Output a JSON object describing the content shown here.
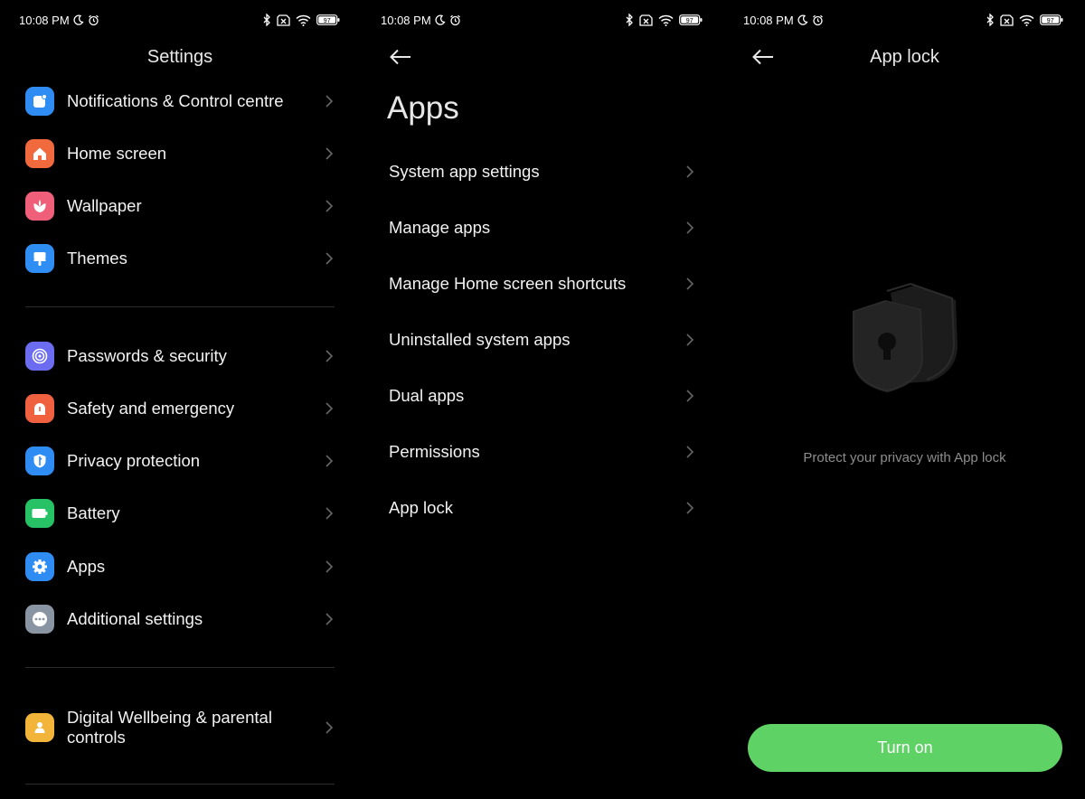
{
  "status_bar": {
    "time": "10:08 PM",
    "battery": "97"
  },
  "settings_screen": {
    "title": "Settings",
    "items": [
      {
        "label": "Notifications & Control centre",
        "icon": "notifications-icon",
        "color": "#2f8cf3"
      },
      {
        "label": "Home screen",
        "icon": "home-icon",
        "color": "#f06a3d"
      },
      {
        "label": "Wallpaper",
        "icon": "wallpaper-flower-icon",
        "color": "#ef5f7a"
      },
      {
        "label": "Themes",
        "icon": "themes-brush-icon",
        "color": "#2e8ef3"
      },
      {
        "label": "Passwords & security",
        "icon": "fingerprint-icon",
        "color": "#6b6cf0"
      },
      {
        "label": "Safety and emergency",
        "icon": "emergency-icon",
        "color": "#f0613f"
      },
      {
        "label": "Privacy protection",
        "icon": "privacy-shield-icon",
        "color": "#2f8cf3"
      },
      {
        "label": "Battery",
        "icon": "battery-icon",
        "color": "#27c265"
      },
      {
        "label": "Apps",
        "icon": "apps-gear-icon",
        "color": "#2f8cf3"
      },
      {
        "label": "Additional settings",
        "icon": "more-dots-icon",
        "color": "#8a95a3"
      },
      {
        "label": "Digital Wellbeing & parental controls",
        "icon": "wellbeing-person-icon",
        "color": "#f2b53a"
      }
    ]
  },
  "apps_screen": {
    "title": "Apps",
    "items": [
      {
        "label": "System app settings"
      },
      {
        "label": "Manage apps"
      },
      {
        "label": "Manage Home screen shortcuts"
      },
      {
        "label": "Uninstalled system apps"
      },
      {
        "label": "Dual apps"
      },
      {
        "label": "Permissions"
      },
      {
        "label": "App lock"
      }
    ]
  },
  "app_lock_screen": {
    "title": "App lock",
    "description": "Protect your privacy with App lock",
    "button_label": "Turn on",
    "accent_color": "#5ed264"
  }
}
